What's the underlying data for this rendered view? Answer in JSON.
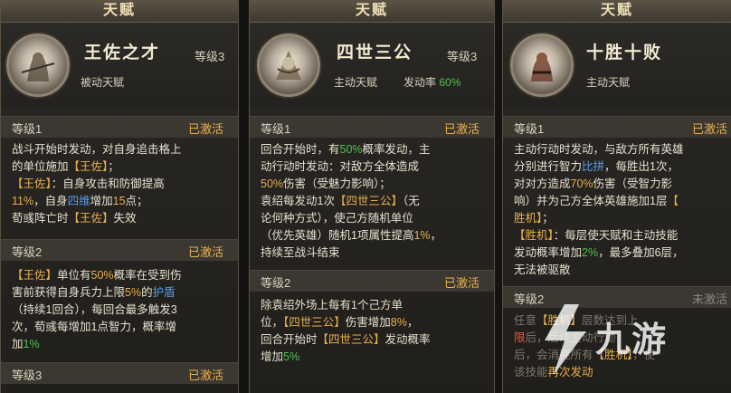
{
  "panels": [
    {
      "tab": "天赋",
      "name": "王佐之才",
      "level": "等级3",
      "type": "被动天赋",
      "sections": [
        {
          "level": "等级1",
          "status": "已激活",
          "lines": [
            "战斗开始时发动，对自身追击格上",
            "的单位施加【王佐】；",
            "【王佐】：自身攻击和防御提高",
            "11%，自身四维增加15点；",
            "荀彧阵亡时【王佐】失效"
          ]
        },
        {
          "level": "等级2",
          "status": "已激活",
          "lines": [
            "【王佐】单位有50%概率在受到伤",
            "害前获得自身兵力上限5%的护盾",
            "（持续1回合），每回合最多触发3",
            "次，荀彧每增加1点智力，概率增",
            "加1%"
          ]
        },
        {
          "level": "等级3",
          "status": "已激活",
          "lines": []
        }
      ]
    },
    {
      "tab": "天赋",
      "name": "四世三公",
      "level": "等级3",
      "type": "主动天赋",
      "rate_label": "发动率",
      "rate_value": "60%",
      "sections": [
        {
          "level": "等级1",
          "status": "已激活",
          "lines": [
            "回合开始时，有50%概率发动，主",
            "动行动时发动：对敌方全体造成",
            "50%伤害（受魅力影响）；",
            "袁绍每发动1次【四世三公】（无",
            "论何种方式），使己方随机单位",
            "（优先英雄）随机1项属性提高1%，",
            "持续至战斗结束"
          ]
        },
        {
          "level": "等级2",
          "status": "已激活",
          "lines": [
            "除袁绍外场上每有1个己方单",
            "位，【四世三公】伤害增加8%，",
            "回合开始时【四世三公】发动概率",
            "增加5%"
          ]
        }
      ]
    },
    {
      "tab": "天赋",
      "name": "十胜十败",
      "type": "主动天赋",
      "sections": [
        {
          "level": "等级1",
          "status": "已激活",
          "lines": [
            "主动行动时发动，与敌方所有英雄",
            "分别进行智力比拼，每胜出1次，",
            "对对方造成70%伤害（受智力影",
            "响）并为己方全体英雄施加1层【",
            "胜机】；",
            "【胜机】：每层使天赋和主动技能",
            "发动概率增加2%，最多叠加6层，",
            "无法被驱散"
          ]
        },
        {
          "level": "等级2",
          "status": "未激活",
          "lines": [
            "任意【胜机】层数达到上",
            "限后，后续主动行动",
            "后，会消耗所有【胜机】，使",
            "该技能再次发动"
          ]
        }
      ]
    }
  ],
  "watermark": {
    "brand": "九游"
  }
}
